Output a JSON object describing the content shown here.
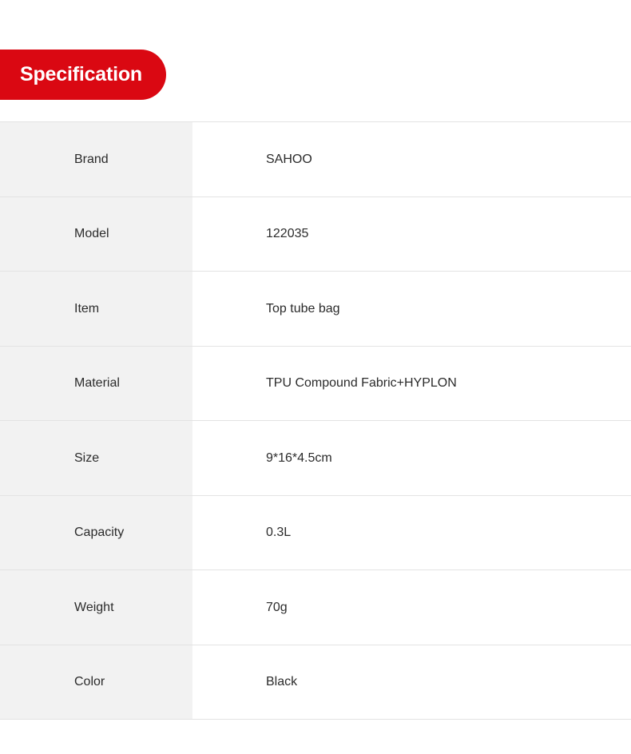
{
  "section": {
    "title": "Specification",
    "badge_color": "#DA0812",
    "badge_text_color": "#FFFFFF"
  },
  "table": {
    "label_column_bg": "#F2F2F2",
    "value_column_bg": "#FFFFFF",
    "border_color": "#E3E3E3",
    "rows": [
      {
        "label": "Brand",
        "value": "SAHOO"
      },
      {
        "label": "Model",
        "value": "122035"
      },
      {
        "label": "Item",
        "value": "Top tube bag"
      },
      {
        "label": "Material",
        "value": "TPU Compound Fabric+HYPLON"
      },
      {
        "label": "Size",
        "value": "9*16*4.5cm"
      },
      {
        "label": "Capacity",
        "value": "0.3L"
      },
      {
        "label": "Weight",
        "value": "70g"
      },
      {
        "label": "Color",
        "value": "Black"
      }
    ]
  }
}
